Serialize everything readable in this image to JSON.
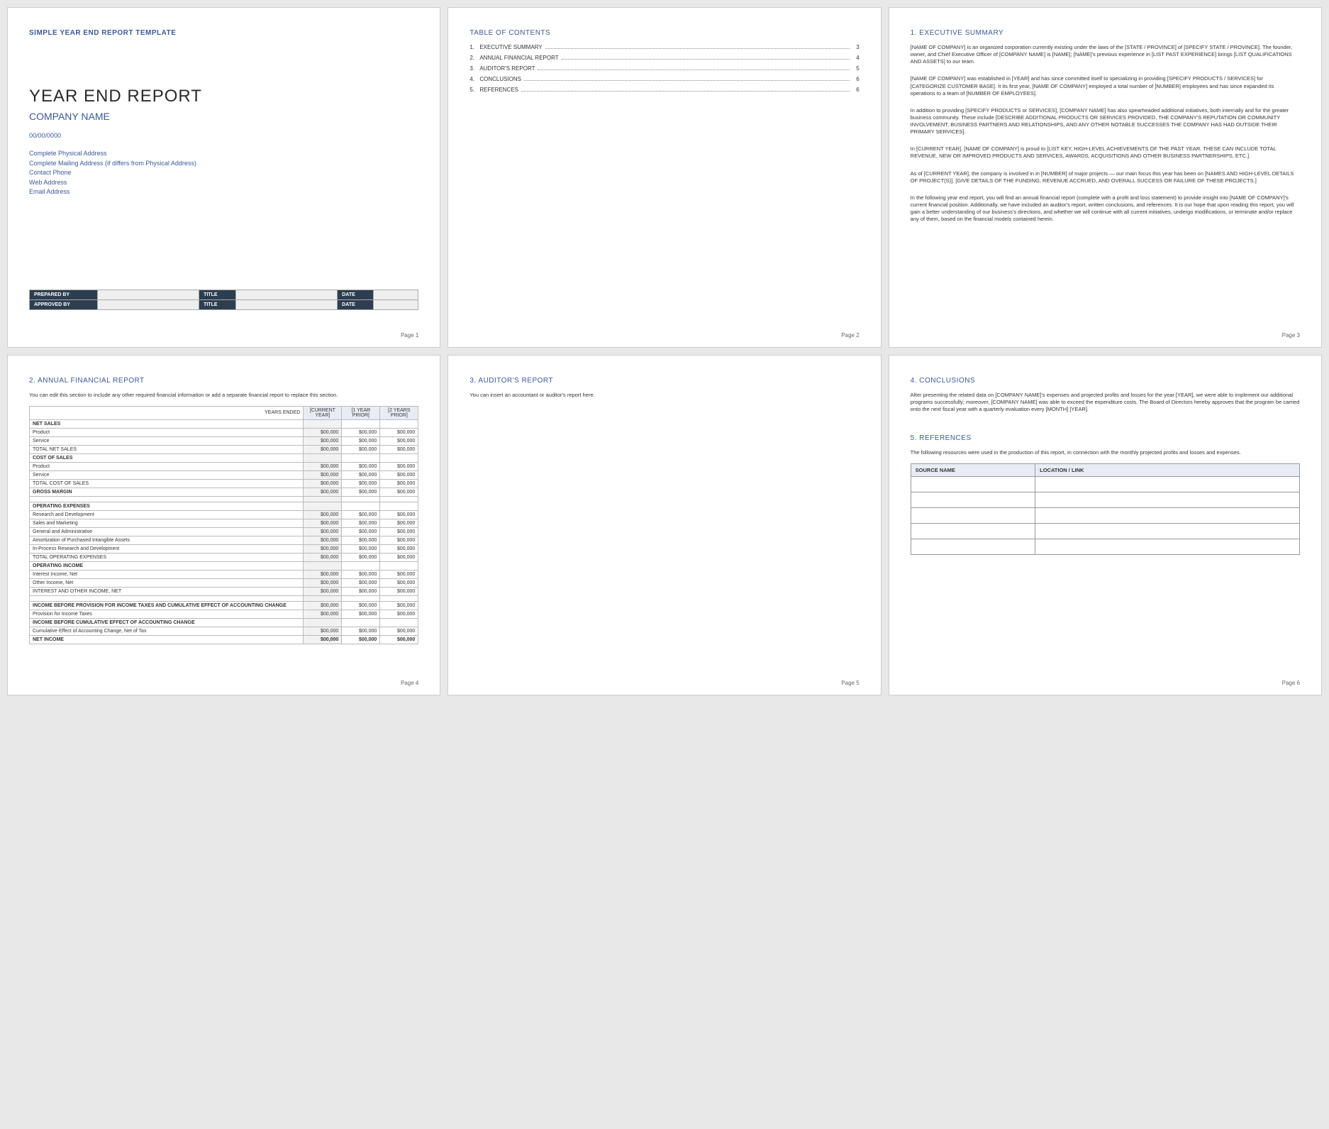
{
  "template_label": "SIMPLE YEAR END REPORT TEMPLATE",
  "page1": {
    "title": "YEAR END REPORT",
    "company": "COMPANY NAME",
    "date": "00/00/0000",
    "address_lines": [
      "Complete Physical Address",
      "Complete Mailing Address (if differs from Physical Address)",
      "Contact Phone",
      "Web Address",
      "Email Address"
    ],
    "meta_labels": {
      "prepared_by": "PREPARED BY",
      "approved_by": "APPROVED BY",
      "title": "TITLE",
      "date": "DATE"
    }
  },
  "toc": {
    "heading": "TABLE OF CONTENTS",
    "items": [
      {
        "n": "1.",
        "label": "EXECUTIVE SUMMARY",
        "page": "3"
      },
      {
        "n": "2.",
        "label": "ANNUAL FINANCIAL REPORT",
        "page": "4"
      },
      {
        "n": "3.",
        "label": "AUDITOR'S REPORT",
        "page": "5"
      },
      {
        "n": "4.",
        "label": "CONCLUSIONS",
        "page": "6"
      },
      {
        "n": "5.",
        "label": "REFERENCES",
        "page": "6"
      }
    ]
  },
  "exec": {
    "heading": "1. EXECUTIVE SUMMARY",
    "paras": [
      "[NAME OF COMPANY] is an organized corporation currently existing under the laws of the [STATE / PROVINCE] of [SPECIFY STATE / PROVINCE]. The founder, owner, and Chief Executive Officer of [COMPANY NAME] is [NAME]; [NAME]'s previous experience in [LIST PAST EXPERIENCE] brings [LIST QUALIFICATIONS AND ASSETS] to our team.",
      "[NAME OF COMPANY] was established in [YEAR] and has since committed itself to specializing in providing [SPECIFY PRODUCTS / SERVICES] for [CATEGORIZE CUSTOMER BASE]. It its first year, [NAME OF COMPANY] employed a total number of [NUMBER] employees and has since expanded its operations to a team of [NUMBER OF EMPLOYEES].",
      "In addition to providing [SPECIFY PRODUCTS or SERVICES], [COMPANY NAME] has also spearheaded additional initiatives, both internally and for the greater business community. These include [DESCRIBE ADDITIONAL PRODUCTS OR SERVICES PROVIDED, THE COMPANY'S REPUTATION OR COMMUNITY INVOLVEMENT, BUSINESS PARTNERS AND RELATIONSHIPS, AND ANY OTHER NOTABLE SUCCESSES THE COMPANY HAS HAD OUTSIDE THEIR PRIMARY SERVICES].",
      "In [CURRENT YEAR], [NAME OF COMPANY] is proud to [LIST KEY, HIGH-LEVEL ACHIEVEMENTS OF THE PAST YEAR. THESE CAN INCLUDE TOTAL REVENUE, NEW OR IMPROVED PRODUCTS AND SERVICES, AWARDS, ACQUISITIONS AND OTHER BUSINESS PARTNERSHIPS, ETC.].",
      "As of [CURRENT YEAR], the company is involved in in [NUMBER] of major projects — our main focus this year has been on [NAMES AND HIGH-LEVEL DETAILS OF PROJECT(S)]. [GIVE DETAILS OF THE FUNDING, REVENUE ACCRUED, AND OVERALL SUCCESS OR FAILURE OF THESE PROJECTS.]",
      "In the following year end report, you will find an annual financial report (complete with a profit and loss statement) to provide insight into [NAME OF COMPANY]'s current financial position. Additionally, we have included an auditor's report, written conclusions, and references. It is our hope that upon reading this report, you will gain a better understanding of our business's directions, and whether we will continue with all current initiatives, undergo modifications, or terminate and/or replace any of them, based on the financial models contained herein."
    ]
  },
  "financial": {
    "heading": "2. ANNUAL FINANCIAL REPORT",
    "instr": "You can edit this section to include any other required financial information or add a separate financial report to replace this section.",
    "years_ended": "YEARS ENDED",
    "cols": [
      "[CURRENT YEAR]",
      "[1 YEAR PRIOR]",
      "[2 YEARS PRIOR]"
    ],
    "val": "$00,000",
    "sections": {
      "net_sales": "NET SALES",
      "product": "Product",
      "service": "Service",
      "total_net_sales": "TOTAL NET SALES",
      "cost_of_sales": "COST OF SALES",
      "total_cost_of_sales": "TOTAL COST OF SALES",
      "gross_margin": "GROSS MARGIN",
      "operating_expenses": "OPERATING EXPENSES",
      "rd": "Research and Development",
      "sales_mkt": "Sales and Marketing",
      "gen_admin": "General and Administrative",
      "amort": "Amortization of Purchased Intangible Assets",
      "inproc_rd": "In-Process Research and Development",
      "total_opex": "TOTAL OPERATING EXPENSES",
      "operating_income": "OPERATING INCOME",
      "interest_inc": "Interest Income, Net",
      "other_inc": "Other Income, Net",
      "int_other_net": "INTEREST AND OTHER INCOME, NET",
      "inc_before_prov": "INCOME BEFORE PROVISION FOR INCOME TAXES AND CUMULATIVE EFFECT OF ACCOUNTING CHANGE",
      "prov_taxes": "Provision for Income Taxes",
      "inc_before_cum": "INCOME BEFORE CUMULATIVE EFFECT OF ACCOUNTING CHANGE",
      "cum_effect": "Cumulative Effect of Accounting Change, Net of Tax",
      "net_income": "NET INCOME"
    }
  },
  "auditor": {
    "heading": "3. AUDITOR'S REPORT",
    "text": "You can insert an accountant or auditor's report here."
  },
  "conclusions": {
    "heading": "4. CONCLUSIONS",
    "text": "After presenting the related data on [COMPANY NAME]'s expenses and projected profits and losses for the year [YEAR], we were able to implement our additional programs successfully; moreover, [COMPANY NAME] was able to exceed the expenditure costs. The Board of Directors hereby approves that the program be carried onto the next fiscal year with a quarterly evaluation every [MONTH] [YEAR]."
  },
  "references": {
    "heading": "5. REFERENCES",
    "text": "The following resources were used in the production of this report, in connection with the monthly projected profits and losses and expenses.",
    "col1": "SOURCE NAME",
    "col2": "LOCATION / LINK"
  },
  "page_labels": {
    "p1": "Page 1",
    "p2": "Page 2",
    "p3": "Page 3",
    "p4": "Page 4",
    "p5": "Page 5",
    "p6": "Page 6"
  }
}
